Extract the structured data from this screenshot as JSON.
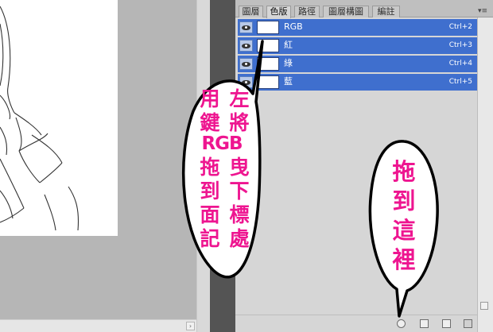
{
  "panel": {
    "tabs": [
      {
        "label": "圖層",
        "active": false
      },
      {
        "label": "色版",
        "active": true
      },
      {
        "label": "路徑",
        "active": false
      },
      {
        "label": "圖層構圖",
        "active": false
      },
      {
        "label": "編註",
        "active": false
      }
    ],
    "menu_icon": "panel-menu-icon",
    "channels": [
      {
        "name": "RGB",
        "shortcut": "Ctrl+2",
        "visible": true
      },
      {
        "name": "紅",
        "shortcut": "Ctrl+3",
        "visible": true
      },
      {
        "name": "綠",
        "shortcut": "Ctrl+4",
        "visible": true
      },
      {
        "name": "藍",
        "shortcut": "Ctrl+5",
        "visible": true
      }
    ],
    "bottom_icons": [
      "load-channel-as-selection-icon",
      "save-selection-as-channel-icon",
      "new-channel-icon",
      "delete-channel-icon"
    ]
  },
  "annotations": {
    "left_bubble": {
      "column_right": [
        "左",
        "將",
        "曳",
        "下",
        "標",
        "處"
      ],
      "column_left": [
        "用",
        "鍵",
        "RGB",
        "拖",
        "到",
        "面",
        "記"
      ]
    },
    "right_bubble": {
      "text": [
        "拖",
        "到",
        "這",
        "裡"
      ]
    }
  },
  "colors": {
    "selection_blue": "#3f6fce",
    "annotation_pink": "#ee1590",
    "panel_gray": "#d6d6d6"
  }
}
